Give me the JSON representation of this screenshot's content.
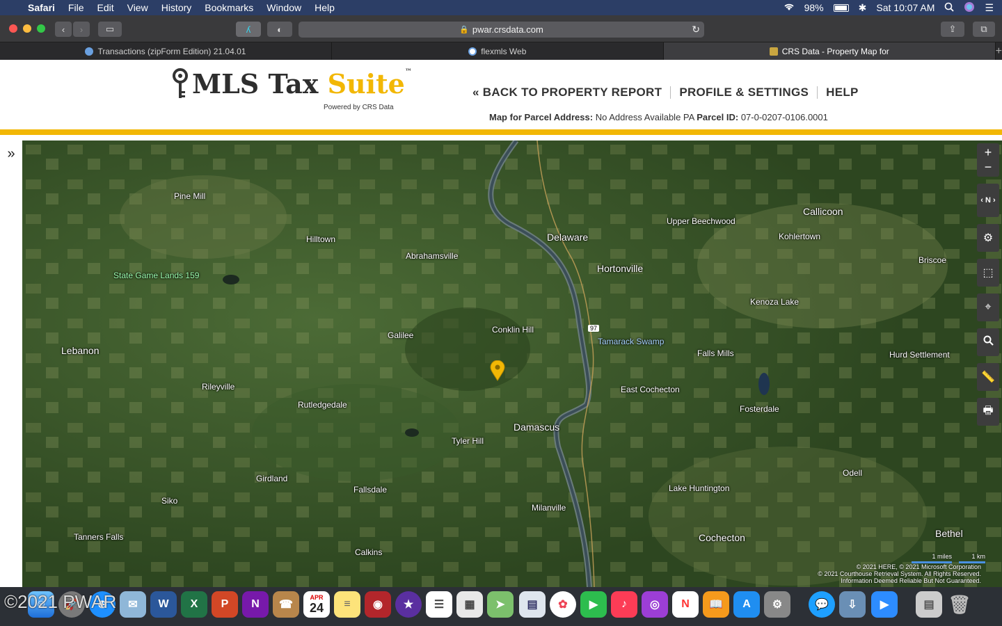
{
  "menubar": {
    "app": "Safari",
    "items": [
      "File",
      "Edit",
      "View",
      "History",
      "Bookmarks",
      "Window",
      "Help"
    ],
    "battery": "98%",
    "clock": "Sat 10:07 AM"
  },
  "toolbar": {
    "url": "pwar.crsdata.com"
  },
  "tabs": [
    {
      "label": "Transactions (zipForm Edition) 21.04.01"
    },
    {
      "label": "flexmls Web"
    },
    {
      "label": "CRS Data - Property Map for"
    }
  ],
  "header": {
    "logo_main": "MLS Tax ",
    "logo_suite": "Suite",
    "logo_tm": "™",
    "logo_powered": "Powered by CRS Data",
    "nav": {
      "back": "« BACK TO PROPERTY REPORT",
      "profile": "PROFILE & SETTINGS",
      "help": "HELP"
    },
    "parcel_address_label": "Map for Parcel Address:",
    "parcel_address_value": "No Address Available PA",
    "parcel_id_label": "Parcel ID:",
    "parcel_id_value": "07-0-0207-0106.0001"
  },
  "map": {
    "labels": [
      "Pine Mill",
      "Hilltown",
      "Abrahamsville",
      "State Game Lands 159",
      "Delaware",
      "Upper Beechwood",
      "Callicoon",
      "Kohlertown",
      "Hortonville",
      "Briscoe",
      "Kenoza Lake",
      "Conklin Hill",
      "Tamarack Swamp",
      "Galilee",
      "Lebanon",
      "Falls Mills",
      "Hurd Settlement",
      "Rileyville",
      "Rutledgedale",
      "East Cochecton",
      "Fosterdale",
      "Damascus",
      "Tyler Hill",
      "Odell",
      "Girdland",
      "Fallsdale",
      "Lake Huntington",
      "Siko",
      "Milanville",
      "Tanners Falls",
      "Cochecton",
      "Bethel",
      "Calkins",
      "97"
    ],
    "scale": [
      "1 miles",
      "1 km"
    ],
    "attribution": [
      "© 2021 HERE, © 2021 Microsoft Corporation",
      "© 2021 Courthouse Retrieval System. All Rights Reserved.",
      "Information Deemed Reliable But Not Guaranteed."
    ],
    "controls": [
      "zoom-in",
      "zoom-out",
      "compass",
      "settings",
      "extent",
      "locate",
      "search",
      "measure",
      "print"
    ]
  },
  "watermark": "©2021 PWAR",
  "dock": {
    "apps": [
      "Finder",
      "Launchpad",
      "Safari",
      "Mail",
      "Word",
      "Excel",
      "PowerPoint",
      "OneNote",
      "Contacts",
      "Calendar",
      "Notes",
      "Photo Booth",
      "iMovie",
      "Reminders",
      "Numbers",
      "Maps",
      "Preview",
      "Photos",
      "FaceTime",
      "Music",
      "Podcasts",
      "News",
      "Books",
      "App Store",
      "System Preferences",
      "Messages",
      "Mail Downloads",
      "Zoom",
      "Documents",
      "Trash"
    ],
    "calendar_month": "APR",
    "calendar_day": "24"
  }
}
